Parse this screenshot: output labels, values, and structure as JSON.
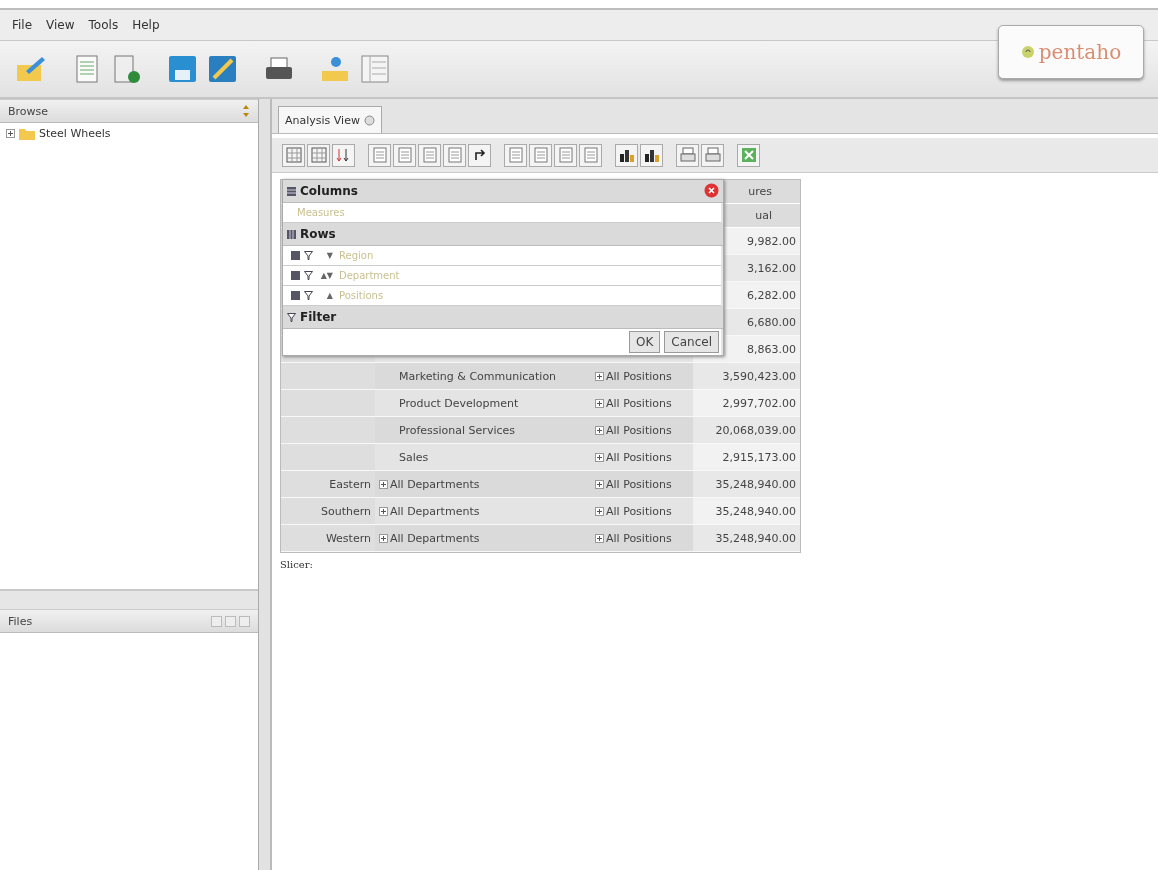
{
  "menu": [
    "File",
    "View",
    "Tools",
    "Help"
  ],
  "logo": {
    "text": "pentaho"
  },
  "browse": {
    "title": "Browse",
    "tree": [
      {
        "label": "Steel Wheels",
        "expanded": false
      }
    ]
  },
  "files": {
    "title": "Files"
  },
  "tabs": [
    {
      "label": "Analysis View",
      "selected": true
    }
  ],
  "navigator": {
    "columns_title": "Columns",
    "columns": [
      "Measures"
    ],
    "rows_title": "Rows",
    "rows": [
      {
        "label": "Region",
        "sort": "▼"
      },
      {
        "label": "Department",
        "sort": "▲▼"
      },
      {
        "label": "Positions",
        "sort": "▲"
      }
    ],
    "filter_title": "Filter",
    "buttons": [
      "OK",
      "Cancel"
    ]
  },
  "table": {
    "headers": [
      "ures",
      "ual"
    ],
    "rows": [
      {
        "value": "9,982.00"
      },
      {
        "value": "3,162.00"
      },
      {
        "value": "6,282.00"
      },
      {
        "value": "6,680.00"
      },
      {
        "value": "8,863.00"
      },
      {
        "department": {
          "label": "Marketing & Communication",
          "expandable": false
        },
        "position": "All Positions",
        "value": "3,590,423.00"
      },
      {
        "department": {
          "label": "Product Development",
          "expandable": false
        },
        "position": "All Positions",
        "value": "2,997,702.00"
      },
      {
        "department": {
          "label": "Professional Services",
          "expandable": false
        },
        "position": "All Positions",
        "value": "20,068,039.00"
      },
      {
        "department": {
          "label": "Sales",
          "expandable": false
        },
        "position": "All Positions",
        "value": "2,915,173.00"
      },
      {
        "region": "Eastern",
        "department": {
          "label": "All Departments",
          "expandable": true
        },
        "position": "All Positions",
        "value": "35,248,940.00"
      },
      {
        "region": "Southern",
        "department": {
          "label": "All Departments",
          "expandable": true
        },
        "position": "All Positions",
        "value": "35,248,940.00"
      },
      {
        "region": "Western",
        "department": {
          "label": "All Departments",
          "expandable": true
        },
        "position": "All Positions",
        "value": "35,248,940.00"
      }
    ],
    "slicer": "Slicer:"
  }
}
